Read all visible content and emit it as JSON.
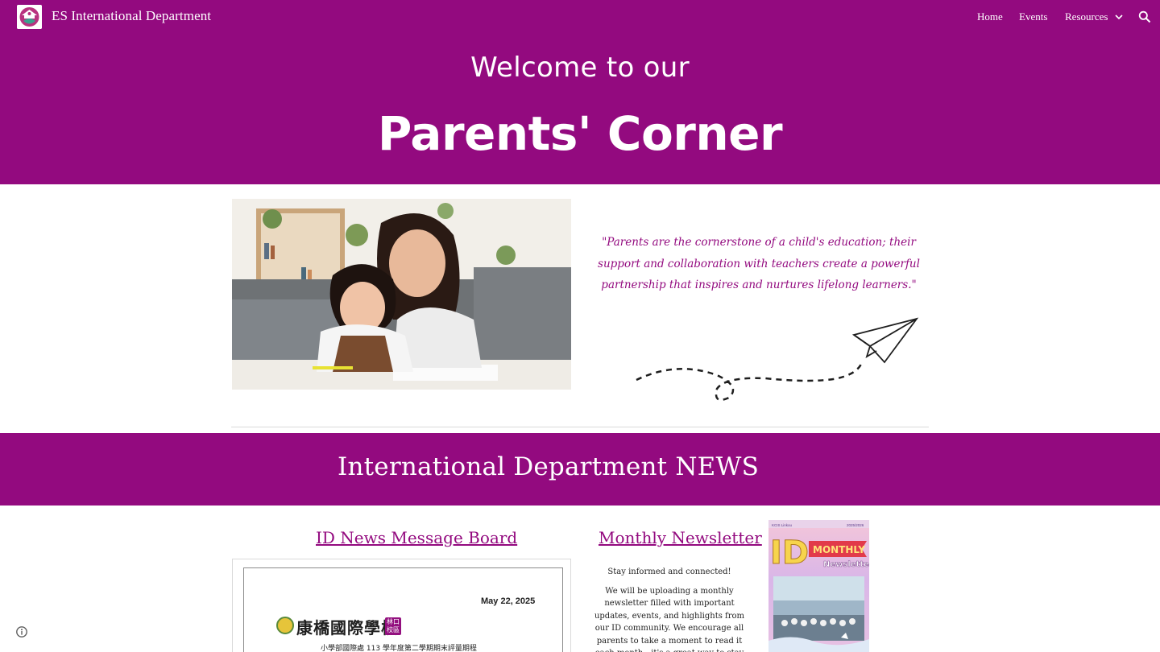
{
  "header": {
    "site_title": "ES International Department",
    "logo_icon": "school-logo-icon",
    "nav": [
      {
        "label": "Home"
      },
      {
        "label": "Events"
      },
      {
        "label": "Resources",
        "has_dropdown": true
      }
    ],
    "search_icon": "search-icon"
  },
  "hero": {
    "subtitle": "Welcome to our",
    "title": "Parents' Corner",
    "background": "#930a7f"
  },
  "intro": {
    "photo": "mother-and-daughter-photo",
    "quote": "\"Parents are the cornerstone of a child's education; their support and collaboration with teachers create a powerful partnership that inspires and nurtures lifelong learners.\"",
    "decoration": "paper-plane-icon"
  },
  "news": {
    "band_title": "International Department NEWS",
    "message_board": {
      "heading": "ID News Message Board",
      "notice_date": "May 22, 2025",
      "school_name": "康橋國際學校",
      "school_badge": "林口校區",
      "notice_line": "小學部國際處 113 學年度第二學期期末評量期程"
    },
    "newsletter": {
      "heading": "Monthly Newsletter",
      "lead": "Stay informed and connected!",
      "body": "We will be uploading a monthly newsletter filled with important updates, events, and highlights from our ID community. We encourage all parents to take a moment to read it each month—it's a great way to stay engaged and",
      "cover": {
        "ribbon": "MONTHLY",
        "word": "Newsletter",
        "big_letters": "ID",
        "tag_left": "KCIS Linkou",
        "tag_right": "2025/2026"
      }
    }
  },
  "footer": {
    "info_icon": "info-icon"
  },
  "colors": {
    "brand": "#930a7f",
    "text": "#212121"
  }
}
